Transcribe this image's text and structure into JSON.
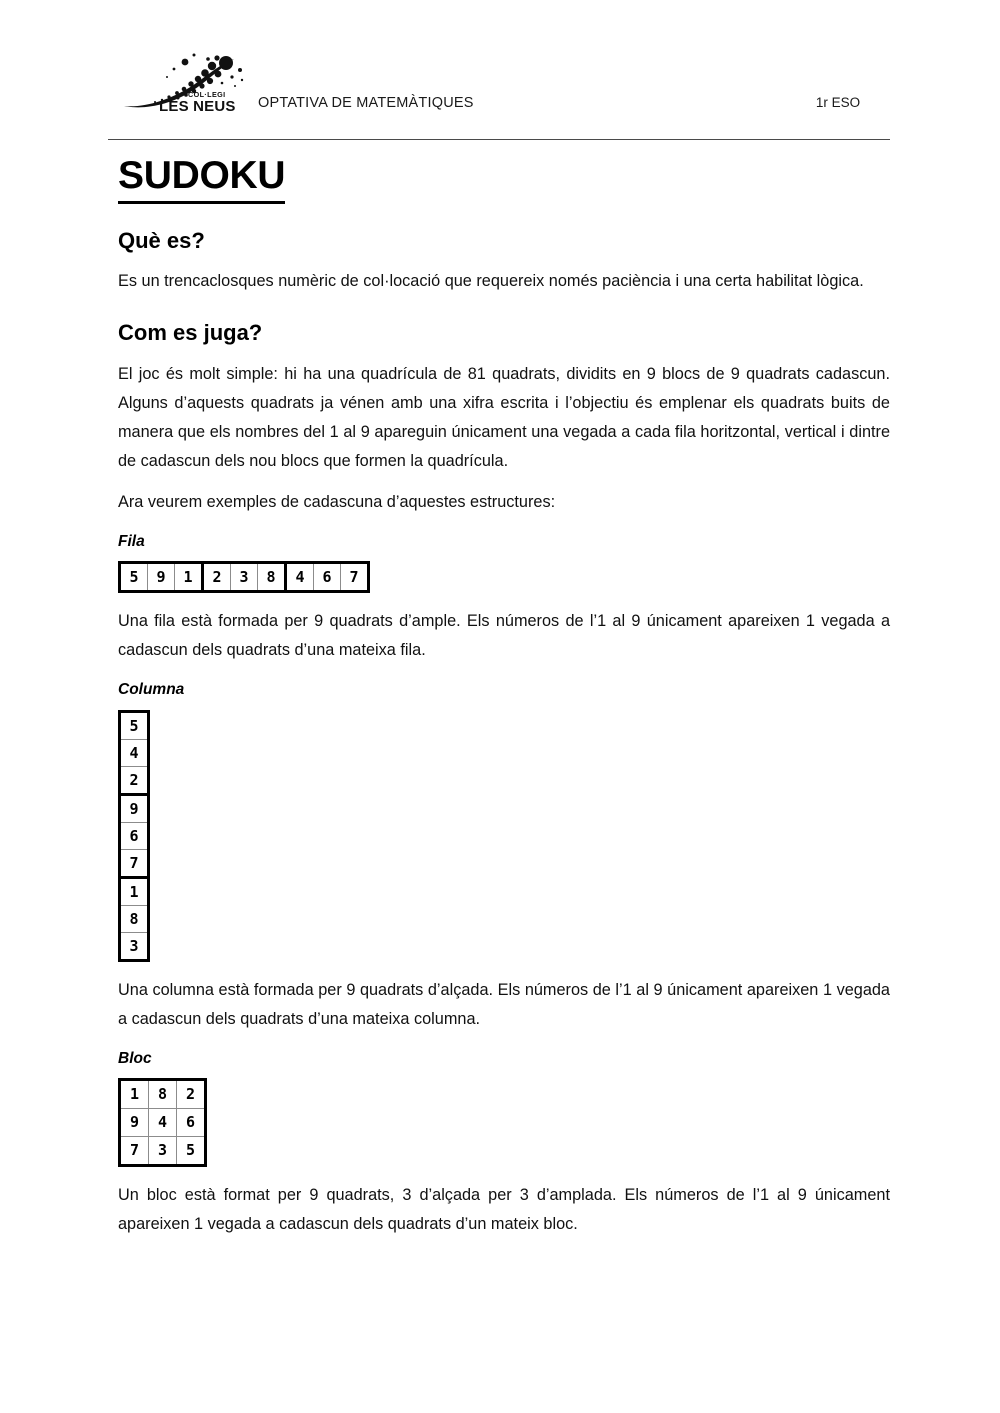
{
  "header": {
    "logo_top_text": "COL·LEGI",
    "logo_main_text": "LES NEUS",
    "title": "OPTATIVA DE MATEMÀTIQUES",
    "course": "1r ESO"
  },
  "document": {
    "title": "SUDOKU",
    "sections": [
      {
        "heading": "Què es?",
        "paragraphs": [
          "Es un trencaclosques numèric de col·locació que requereix només paciència i una certa habilitat lògica."
        ]
      },
      {
        "heading": "Com es juga?",
        "paragraphs": [
          "El joc és molt simple: hi ha una quadrícula de 81 quadrats, dividits en 9 blocs de 9 quadrats cadascun. Alguns d’aquests quadrats ja vénen amb una xifra escrita i l’objectiu és emplenar els quadrats buits de manera que els nombres del 1 al 9 apareguin únicament una vegada a cada fila horitzontal, vertical i dintre de cadascun dels nou blocs que formen la quadrícula.",
          "Ara veurem exemples de cadascuna d’aquestes estructures:"
        ]
      }
    ],
    "examples": [
      {
        "label": "Fila",
        "caption": "Una fila està formada per 9 quadrats d’ample. Els números de l’1 al 9 únicament apareixen 1 vegada a cadascun dels quadrats d’una mateixa fila."
      },
      {
        "label": "Columna",
        "caption": "Una columna està formada per 9 quadrats d’alçada. Els números de l’1 al 9 únicament apareixen 1 vegada a cadascun dels quadrats d’una mateixa columna."
      },
      {
        "label": "Bloc",
        "caption": "Un bloc està format per 9 quadrats, 3 d’alçada per 3 d’amplada. Els números de l’1 al 9 únicament apareixen 1 vegada a cadascun dels quadrats d’un mateix bloc."
      }
    ]
  },
  "grids": {
    "fila": [
      "5",
      "9",
      "1",
      "2",
      "3",
      "8",
      "4",
      "6",
      "7"
    ],
    "columna": [
      "5",
      "4",
      "2",
      "9",
      "6",
      "7",
      "1",
      "8",
      "3"
    ],
    "bloc": [
      [
        "1",
        "8",
        "2"
      ],
      [
        "9",
        "4",
        "6"
      ],
      [
        "7",
        "3",
        "5"
      ]
    ]
  },
  "colors": {
    "page_background": "#ffffff",
    "text": "#000000",
    "header_rule": "#4a4a4a",
    "grid_thick_border": "#000000",
    "grid_thin_border": "#8c8c8c"
  }
}
